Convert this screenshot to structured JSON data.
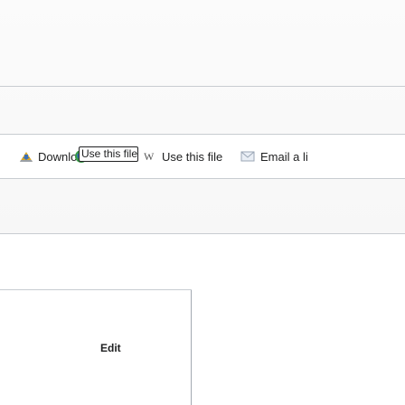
{
  "toolbar": {
    "download_label": "Download",
    "embed_value": "Use this file",
    "use_file_label": "Use this file",
    "email_label": "Email a li"
  },
  "bottom": {
    "edit_label": "Edit"
  },
  "icons": {
    "download": "download-icon",
    "globe": "globe-icon",
    "wiki": "wikipedia-w-icon",
    "email": "email-icon"
  }
}
